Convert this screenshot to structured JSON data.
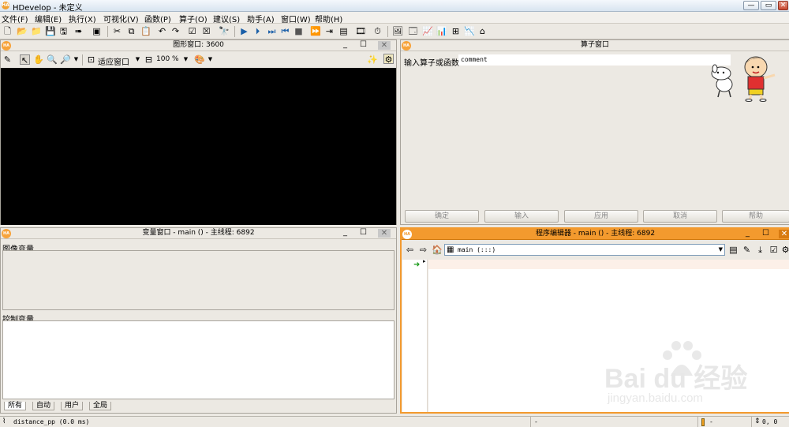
{
  "window": {
    "title": "HDevelop - 未定义",
    "buttons": {
      "minimize": "—",
      "maximize": "▭",
      "close": "✕"
    }
  },
  "menu": [
    {
      "label": "文件(F)"
    },
    {
      "label": "编辑(E)"
    },
    {
      "label": "执行(X)"
    },
    {
      "label": "可视化(V)"
    },
    {
      "label": "函数(P)"
    },
    {
      "label": "算子(O)"
    },
    {
      "label": "建议(S)"
    },
    {
      "label": "助手(A)"
    },
    {
      "label": "窗口(W)"
    },
    {
      "label": "帮助(H)"
    }
  ],
  "graphics_window": {
    "title": "图形窗口: 3600",
    "fit_label": "适应窗口",
    "zoom": "100 %",
    "canvas_color": "#000000"
  },
  "operator_window": {
    "title": "算子窗口",
    "input_label": "输入算子或函数",
    "input_value": "comment",
    "buttons": {
      "ok": "确定",
      "enter": "输入",
      "apply": "应用",
      "cancel": "取消",
      "help": "帮助"
    }
  },
  "variable_window": {
    "title": "变量窗口 - main () - 主线程: 6892",
    "iconic_label": "图像变量",
    "control_label": "控制变量",
    "tabs": [
      "所有",
      "自动",
      "用户",
      "全局"
    ]
  },
  "program_editor": {
    "title": "程序编辑器 - main () - 主线程: 6892",
    "procedure": "main (:::)",
    "accent_color": "#f39a2e"
  },
  "status": {
    "message": "distance_pp (0.0 ms)",
    "dash1": "-",
    "dash2": "-",
    "coords": "0, 0"
  },
  "watermark": {
    "brand": "Bai du 经验",
    "url": "jingyan.baidu.com"
  }
}
